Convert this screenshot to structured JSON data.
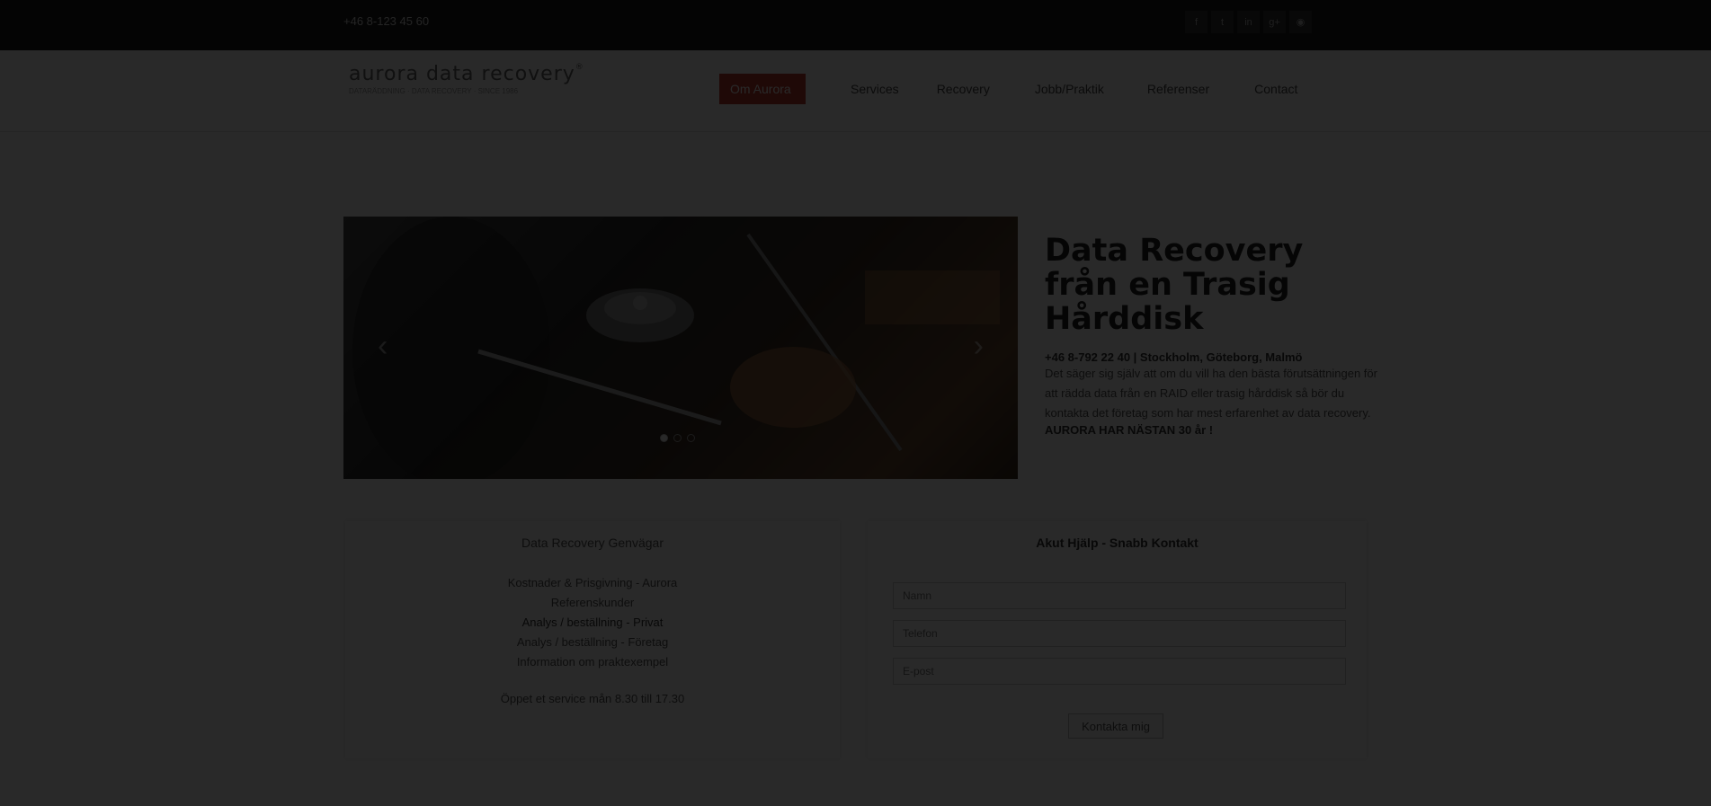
{
  "topbar": {
    "phone": "+46 8-123 45 60",
    "social_icons": [
      "facebook-icon",
      "twitter-icon",
      "linkedin-icon",
      "google-icon",
      "rss-icon"
    ]
  },
  "header": {
    "logo_main": "aurora data recovery",
    "logo_reg": "®",
    "logo_sub": "DATARÄDDNING · DATA RECOVERY · SINCE 1986"
  },
  "nav": {
    "items": [
      {
        "label": "Om Aurora"
      },
      {
        "label": "Services"
      },
      {
        "label": "Recovery"
      },
      {
        "label": "Jobb/Praktik"
      },
      {
        "label": "Referenser"
      },
      {
        "label": "Contact"
      }
    ],
    "active_index": 0,
    "accent": "#c0392b"
  },
  "slider": {
    "prev": "‹",
    "next": "›",
    "slide_count": 3,
    "active_slide": 0
  },
  "hero": {
    "title": "Data Recovery från en Trasig Hårddisk",
    "contact": "+46 8-792 22 40 | Stockholm, Göteborg, Malmö",
    "paragraph": "Det säger sig själv att om du vill ha den bästa förutsättningen för att rädda data från en RAID eller trasig hårddisk så bör du kontakta det företag som har mest erfarenhet av data recovery.",
    "tagline": "AURORA HAR NÄSTAN 30 år !"
  },
  "left_panel": {
    "title": "Data Recovery Genvägar",
    "links": [
      "Kostnader & Prisgivning - Aurora",
      "Referenskunder",
      "Analys / beställning - Privat",
      "Analys / beställning - Företag",
      "Information om praktexempel"
    ],
    "hours": "Öppet et service mån 8.30 till 17.30"
  },
  "right_panel": {
    "title": "Akut Hjälp - Snabb Kontakt",
    "name_placeholder": "Namn",
    "phone_placeholder": "Telefon",
    "email_placeholder": "E-post",
    "submit": "Kontakta mig"
  },
  "colors": {
    "topbar_bg": "#1a1a1a",
    "overlay": "rgba(0,0,0,0.84)"
  }
}
